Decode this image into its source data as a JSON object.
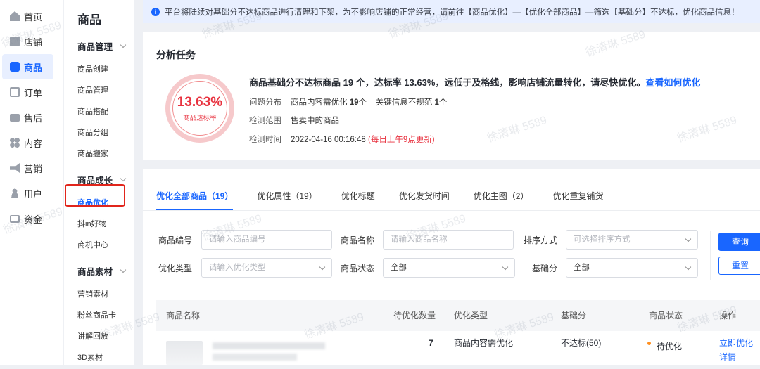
{
  "nav_primary": [
    {
      "label": "首页",
      "icon": "home-icon"
    },
    {
      "label": "店铺",
      "icon": "shop-icon"
    },
    {
      "label": "商品",
      "icon": "goods-icon",
      "active": true
    },
    {
      "label": "订单",
      "icon": "order-icon"
    },
    {
      "label": "售后",
      "icon": "after-sale-icon"
    },
    {
      "label": "内容",
      "icon": "content-icon"
    },
    {
      "label": "营销",
      "icon": "marketing-icon"
    },
    {
      "label": "用户",
      "icon": "user-icon"
    },
    {
      "label": "资金",
      "icon": "fund-icon"
    }
  ],
  "nav_secondary": {
    "title": "商品",
    "groups": [
      {
        "label": "商品管理",
        "items": [
          "商品创建",
          "商品管理",
          "商品搭配",
          "商品分组",
          "商品搬家"
        ]
      },
      {
        "label": "商品成长",
        "items": [
          "商品优化",
          "抖in好物",
          "商机中心"
        ]
      },
      {
        "label": "商品素材",
        "items": [
          "营销素材",
          "粉丝商品卡",
          "讲解回放",
          "3D素材"
        ]
      }
    ],
    "active_item": "商品优化"
  },
  "notice": "平台将陆续对基础分不达标商品进行清理和下架，为不影响店铺的正常经营，请前往【商品优化】—【优化全部商品】—筛选【基础分】不达标，优化商品信息！",
  "analysis": {
    "title": "分析任务",
    "rate": "13.63%",
    "rate_label": "商品达标率",
    "rate_value": 0.1363,
    "summary": "商品基础分不达标商品 19 个，达标率 13.63%，远低于及格线，影响店铺流量转化，请尽快优化。",
    "summary_link": "查看如何优化",
    "dist_key": "问题分布",
    "dist_a": "商品内容需优化",
    "dist_a_count": "19",
    "dist_unit": "个",
    "dist_b": "关键信息不规范",
    "dist_b_count": "1",
    "scope_key": "检测范围",
    "scope_value": "售卖中的商品",
    "time_key": "检测时间",
    "time_value": "2022-04-16 00:16:48",
    "time_note": "(每日上午9点更新)"
  },
  "tabs": [
    "优化全部商品（19）",
    "优化属性（19）",
    "优化标题",
    "优化发货时间",
    "优化主图（2）",
    "优化重复铺货"
  ],
  "filters": {
    "code_label": "商品编号",
    "code_placeholder": "请输入商品编号",
    "name_label": "商品名称",
    "name_placeholder": "请输入商品名称",
    "sort_label": "排序方式",
    "sort_placeholder": "可选择排序方式",
    "type_label": "优化类型",
    "type_placeholder": "请输入优化类型",
    "status_label": "商品状态",
    "status_value": "全部",
    "score_label": "基础分",
    "score_value": "全部",
    "query": "查询",
    "reset": "重置"
  },
  "table": {
    "headers": [
      "商品名称",
      "待优化数量",
      "优化类型",
      "基础分",
      "商品状态",
      "操作"
    ],
    "rows": [
      {
        "count": "7",
        "type": "商品内容需优化",
        "score": "不达标(50)",
        "status": "待优化",
        "action1": "立即优化",
        "action2": "详情"
      }
    ]
  },
  "watermark": "徐清琳 5589",
  "colors": {
    "accent": "#1966ff",
    "danger": "#e8323f",
    "highlight": "#e1251b"
  }
}
